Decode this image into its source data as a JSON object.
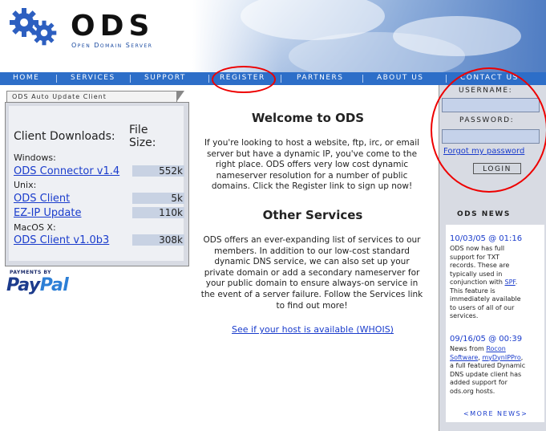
{
  "logo": {
    "title": "ODS",
    "subtitle": "Open Domain Server"
  },
  "nav": {
    "items": [
      {
        "label": "HOME"
      },
      {
        "label": "SERVICES"
      },
      {
        "label": "SUPPORT"
      },
      {
        "label": "REGISTER"
      },
      {
        "label": "PARTNERS"
      },
      {
        "label": "ABOUT US"
      },
      {
        "label": "CONTACT US"
      }
    ]
  },
  "left_panel": {
    "tab_title": "ODS Auto Update Client",
    "heading": "Client Downloads:",
    "size_heading_1": "File",
    "size_heading_2": "Size:",
    "groups": [
      {
        "name": "Windows:",
        "items": [
          {
            "label": "ODS Connector v1.4",
            "size": "552k"
          }
        ]
      },
      {
        "name": "Unix:",
        "items": [
          {
            "label": "ODS Client",
            "size": "5k"
          },
          {
            "label": "EZ-IP Update",
            "size": "110k"
          }
        ]
      },
      {
        "name": "MacOS X:",
        "items": [
          {
            "label": "ODS Client v1.0b3",
            "size": "308k"
          }
        ]
      }
    ],
    "paypal_caption": "PAYMENTS BY",
    "paypal_pay": "Pay",
    "paypal_pal": "Pal"
  },
  "main": {
    "welcome_title": "Welcome to ODS",
    "welcome_lines": [
      "If you're looking to host a website, ftp, irc, or email",
      "server but have a dynamic IP, you've come to the",
      "right place. ODS offers very low cost dynamic",
      "nameserver resolution for a number of public",
      "domains. Click the Register link to sign up now!"
    ],
    "services_title": "Other Services",
    "services_lines": [
      "ODS offers an ever-expanding list of services to our",
      "members. In addition to our low-cost standard",
      "dynamic DNS service, we can also set up your",
      "private domain or add a secondary nameserver for",
      "your public domain to ensure always-on service in",
      "the event of a server failure. Follow the Services link",
      "to find out more!"
    ],
    "whois_link": "See if your host is available (WHOIS)"
  },
  "login": {
    "username_label": "USERNAME:",
    "password_label": "PASSWORD:",
    "username_value": "",
    "password_value": "",
    "forgot_link": "Forgot my password",
    "login_button": "LOGIN"
  },
  "news": {
    "title": "ODS NEWS",
    "items": [
      {
        "date": "10/03/05 @ 01:16",
        "lines": [
          "ODS now has full",
          "support for TXT",
          "records. These are",
          "typically used in",
          "conjunction with",
          "This feature is",
          "immediately available",
          "to users of all of our",
          "services."
        ],
        "link": "SPF"
      },
      {
        "date": "09/16/05 @ 00:39",
        "lines": [
          "News from",
          "a full featured Dynamic",
          "DNS update client has",
          "added support for",
          "ods.org hosts."
        ],
        "link_1": "Rocon",
        "link_2": "Software",
        "link_3": "myDynIPPro"
      }
    ],
    "more_link": "<MORE NEWS>"
  },
  "colors": {
    "nav_blue": "#2d6ec8",
    "link_blue": "#1a3ccc",
    "highlight_red": "#e00000",
    "panel_gray": "#d8dbe3"
  }
}
